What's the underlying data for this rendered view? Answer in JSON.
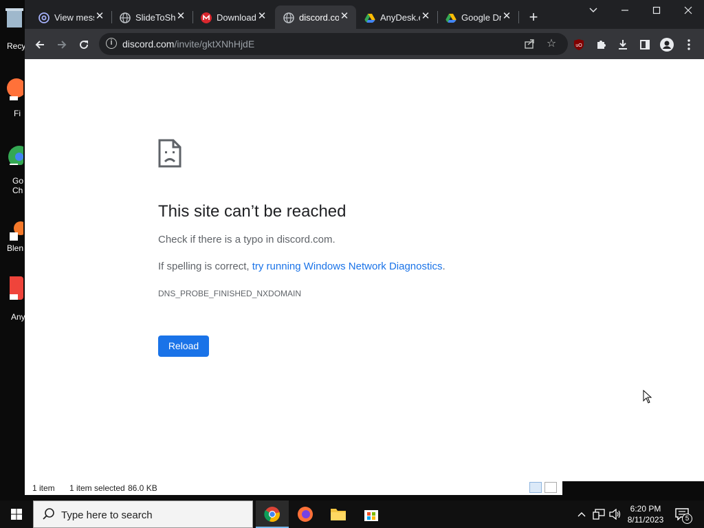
{
  "desktop": {
    "icons": [
      {
        "label": "Recy"
      },
      {
        "label": "Fi"
      },
      {
        "label": "Go\nCh"
      },
      {
        "label": "Blen"
      },
      {
        "label": "Any"
      }
    ]
  },
  "explorer": {
    "status_items": "1 item",
    "status_selected": "1 item selected",
    "status_size": "86.0 KB"
  },
  "browser": {
    "tabs": [
      {
        "title": "View mess",
        "icon": "at-sign-icon"
      },
      {
        "title": "SlideToSh",
        "icon": "globe-icon"
      },
      {
        "title": "Download",
        "icon": "mega-icon"
      },
      {
        "title": "discord.co",
        "icon": "globe-icon",
        "active": true
      },
      {
        "title": "AnyDesk.e",
        "icon": "google-drive-icon"
      },
      {
        "title": "Google Dr",
        "icon": "google-drive-icon"
      }
    ],
    "url_host": "discord.com",
    "url_path": "/invite/gktXNhHjdE"
  },
  "error_page": {
    "title": "This site can’t be reached",
    "typo_prefix": "Check if there is a typo in ",
    "typo_domain": "discord.com",
    "typo_suffix": ".",
    "diag_prefix": "If spelling is correct, ",
    "diag_link": "try running Windows Network Diagnostics",
    "diag_suffix": ".",
    "error_code": "DNS_PROBE_FINISHED_NXDOMAIN",
    "reload_label": "Reload"
  },
  "taskbar": {
    "search_placeholder": "Type here to search",
    "time": "6:20 PM",
    "date": "8/11/2023",
    "notification_count": "5"
  },
  "colors": {
    "accent": "#1a73e8",
    "chrome_dark": "#202124",
    "toolbar": "#35363a"
  }
}
